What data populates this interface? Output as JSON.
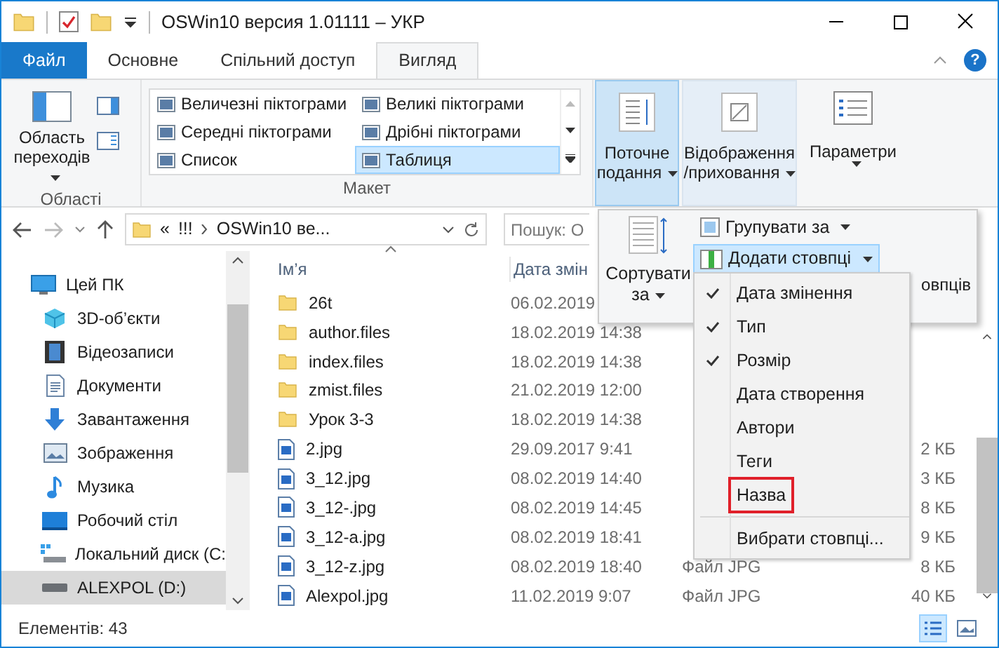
{
  "window": {
    "title": "OSWin10 версия 1.01111 – УКР",
    "help_glyph": "?"
  },
  "ribbon_tabs": [
    {
      "label": "Файл",
      "kind": "file",
      "selected": false
    },
    {
      "label": "Основне",
      "kind": "tab",
      "selected": false
    },
    {
      "label": "Спільний доступ",
      "kind": "tab",
      "selected": false
    },
    {
      "label": "Вигляд",
      "kind": "tab",
      "selected": true
    }
  ],
  "ribbon": {
    "panes_group": {
      "label": "Області",
      "navigation_pane": "Область переходів"
    },
    "layout_group": {
      "label": "Макет",
      "options": [
        {
          "label": "Величезні піктограми",
          "selected": false
        },
        {
          "label": "Великі піктограми",
          "selected": false
        },
        {
          "label": "Середні піктограми",
          "selected": false
        },
        {
          "label": "Дрібні піктограми",
          "selected": false
        },
        {
          "label": "Список",
          "selected": false
        },
        {
          "label": "Таблиця",
          "selected": true
        }
      ]
    },
    "current_view": {
      "label": "Поточне подання",
      "expanded": true
    },
    "show_hide": {
      "label": "Відображення /приховання"
    },
    "options": {
      "label": "Параметри"
    }
  },
  "address_bar": {
    "path": [
      "«",
      "!!!",
      "OSWin10 ве..."
    ],
    "search_placeholder": "Пошук: O"
  },
  "navigation": [
    {
      "label": "Цей ПК",
      "kind": "pc",
      "selected": false,
      "children": [
        {
          "label": "3D-об’єкти",
          "kind": "cube",
          "selected": false
        },
        {
          "label": "Відеозаписи",
          "kind": "video",
          "selected": false
        },
        {
          "label": "Документи",
          "kind": "docs",
          "selected": false
        },
        {
          "label": "Завантаження",
          "kind": "downloads",
          "selected": false
        },
        {
          "label": "Зображення",
          "kind": "pictures",
          "selected": false
        },
        {
          "label": "Музика",
          "kind": "music",
          "selected": false
        },
        {
          "label": "Робочий стіл",
          "kind": "desktop",
          "selected": false
        },
        {
          "label": "Локальний диск (C:",
          "kind": "disk",
          "selected": false
        },
        {
          "label": "ALEXPOL (D:)",
          "kind": "drive",
          "selected": true
        }
      ]
    }
  ],
  "table": {
    "columns": [
      "Ім’я",
      "Дата змін"
    ],
    "rows": [
      {
        "kind": "folder",
        "name": "26t",
        "date": "06.02.2019"
      },
      {
        "kind": "folder",
        "name": "author.files",
        "date": "18.02.2019 14:38"
      },
      {
        "kind": "folder",
        "name": "index.files",
        "date": "18.02.2019 14:38"
      },
      {
        "kind": "folder",
        "name": "zmist.files",
        "date": "21.02.2019 12:00"
      },
      {
        "kind": "folder",
        "name": "Урок 3-3",
        "date": "18.02.2019 14:38"
      },
      {
        "kind": "image",
        "name": "2.jpg",
        "date": "29.09.2017 9:41",
        "size": "2 КБ"
      },
      {
        "kind": "image",
        "name": "3_12.jpg",
        "date": "08.02.2019 14:40",
        "size": "3 КБ"
      },
      {
        "kind": "image",
        "name": "3_12-.jpg",
        "date": "08.02.2019 14:45",
        "size": "8 КБ"
      },
      {
        "kind": "image",
        "name": "3_12-a.jpg",
        "date": "08.02.2019 18:41",
        "size": "9 КБ"
      },
      {
        "kind": "image",
        "name": "3_12-z.jpg",
        "date": "08.02.2019 18:40",
        "type": "Файл JPG",
        "size": "8 КБ"
      },
      {
        "kind": "image",
        "name": "Alexpol.jpg",
        "date": "11.02.2019 9:07",
        "type": "Файл JPG",
        "size": "40 КБ"
      }
    ]
  },
  "current_view_panel": {
    "sort_by": "Сортувати за",
    "group_by": "Групувати за",
    "add_columns": {
      "label": "Додати стовпці",
      "expanded": true
    },
    "size_columns_fragment": "овпців"
  },
  "columns_menu": [
    {
      "kind": "option",
      "label": "Дата змінення",
      "checked": true,
      "highlighted": false
    },
    {
      "kind": "option",
      "label": "Тип",
      "checked": true,
      "highlighted": false
    },
    {
      "kind": "option",
      "label": "Розмір",
      "checked": true,
      "highlighted": false
    },
    {
      "kind": "option",
      "label": "Дата створення",
      "checked": false,
      "highlighted": false
    },
    {
      "kind": "option",
      "label": "Автори",
      "checked": false,
      "highlighted": false
    },
    {
      "kind": "option",
      "label": "Теги",
      "checked": false,
      "highlighted": false
    },
    {
      "kind": "option",
      "label": "Назва",
      "checked": false,
      "highlighted": true
    },
    {
      "kind": "command",
      "label": "Вибрати стовпці...",
      "checked": false,
      "highlighted": false
    }
  ],
  "status_bar": {
    "items_count": "Елементів: 43",
    "views": [
      {
        "kind": "details",
        "selected": true
      },
      {
        "kind": "large",
        "selected": false
      }
    ]
  }
}
